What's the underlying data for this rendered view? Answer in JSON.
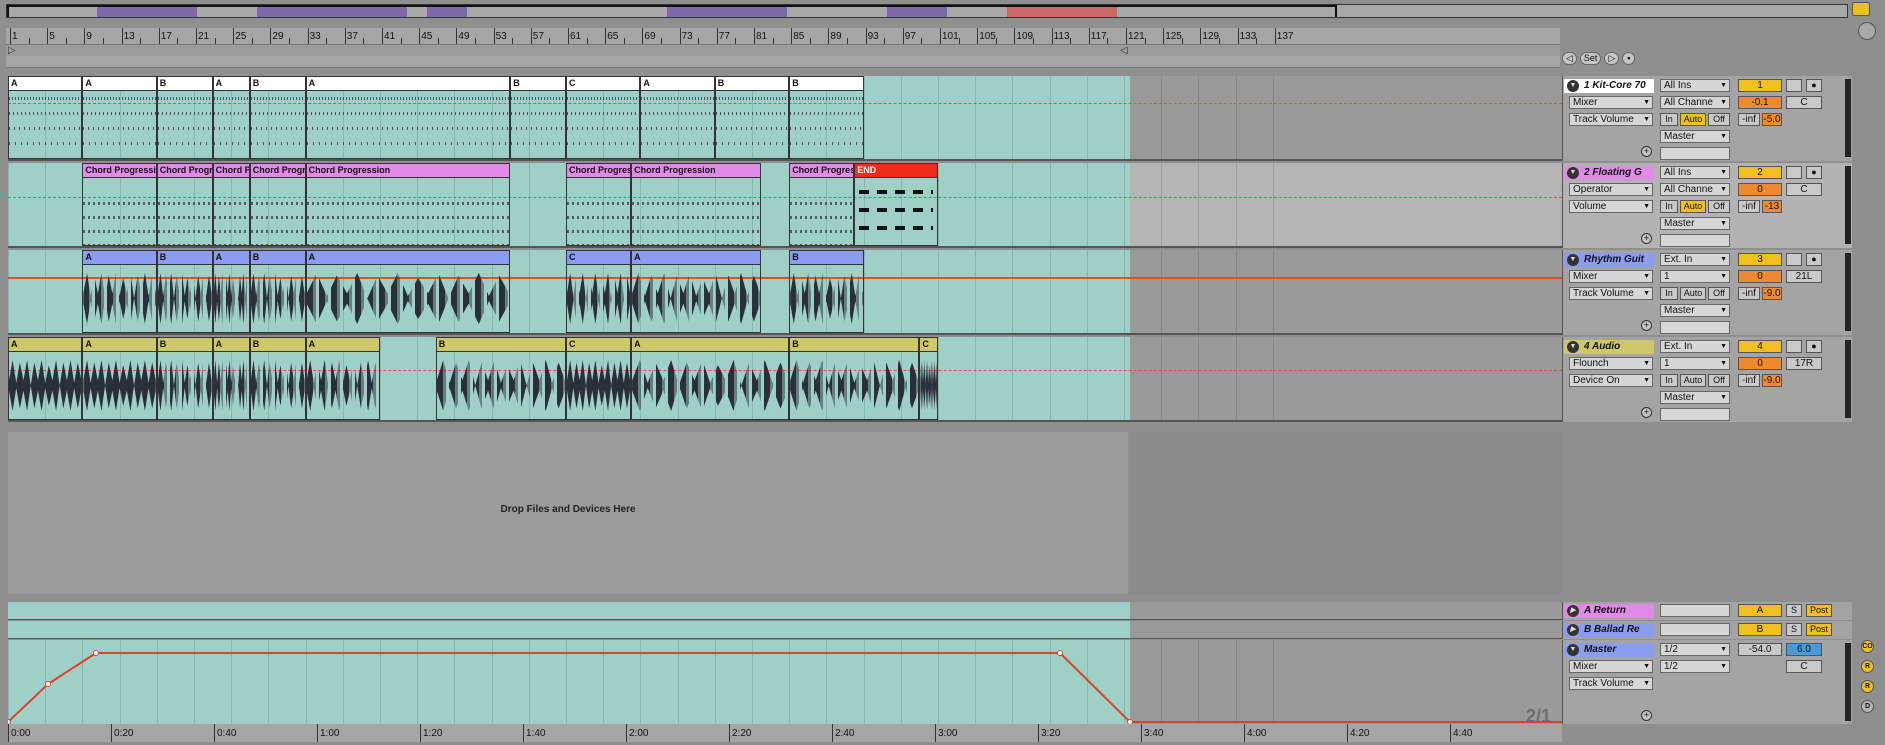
{
  "ruler": {
    "bars": [
      "1",
      "5",
      "9",
      "13",
      "17",
      "21",
      "25",
      "29",
      "33",
      "37",
      "41",
      "45",
      "49",
      "53",
      "57",
      "61",
      "65",
      "69",
      "73",
      "77",
      "81",
      "85",
      "89",
      "93",
      "97",
      "101",
      "105",
      "109",
      "113",
      "117",
      "121",
      "125",
      "129",
      "133",
      "137"
    ]
  },
  "set_controls": {
    "set_label": "Set"
  },
  "tracks": [
    {
      "name": "1 Kit-Core 70",
      "color": "#ffffff",
      "input": "All Ins",
      "device": "Mixer",
      "channel": "All Channe",
      "param": "Track Volume",
      "number": "1",
      "volume": "-0.1",
      "pan": "C",
      "mon_in": "In",
      "mon_auto": "Auto",
      "mon_off": "Off",
      "inf": "-inf",
      "peak": "-5.0",
      "output": "Master",
      "clips": [
        "A",
        "A",
        "B",
        "A",
        "B",
        "A",
        "B",
        "C",
        "A",
        "B",
        "B"
      ]
    },
    {
      "name": "2 Floating G",
      "color": "#e08be8",
      "input": "All Ins",
      "device": "Operator",
      "channel": "All Channe",
      "param": "Volume",
      "number": "2",
      "volume": "0",
      "pan": "C",
      "mon_in": "In",
      "mon_auto": "Auto",
      "mon_off": "Off",
      "inf": "-inf",
      "peak": "-13",
      "output": "Master",
      "clips": [
        "Chord Progression",
        "Chord Progres",
        "Chord Pr",
        "Chord Progres",
        "Chord Progression",
        "Chord Progressi",
        "Chord Progression",
        "Chord Progress",
        "END"
      ]
    },
    {
      "name": "Rhythm Guit",
      "color": "#8b9df0",
      "input": "Ext. In",
      "device": "Mixer",
      "channel": "1",
      "param": "Track Volume",
      "number": "3",
      "volume": "0",
      "pan": "21L",
      "mon_in": "In",
      "mon_auto": "Auto",
      "mon_off": "Off",
      "inf": "-inf",
      "peak": "-9.0",
      "output": "Master",
      "clips": [
        "A",
        "B",
        "A",
        "B",
        "A",
        "C",
        "A",
        "B"
      ]
    },
    {
      "name": "4 Audio",
      "color": "#cfc86a",
      "input": "Ext. In",
      "device": "Flounch",
      "channel": "1",
      "param": "Device On",
      "number": "4",
      "volume": "0",
      "pan": "17R",
      "mon_in": "In",
      "mon_auto": "Auto",
      "mon_off": "Off",
      "inf": "-inf",
      "peak": "-9.0",
      "output": "Master",
      "clips": [
        "A",
        "A",
        "B",
        "A",
        "B",
        "A",
        "B",
        "C",
        "A",
        "B",
        "C"
      ]
    }
  ],
  "drop_message": "Drop Files and Devices Here",
  "returns": [
    {
      "name": "A Return",
      "color": "#e08be8",
      "letter": "A",
      "solo": "S",
      "post": "Post"
    },
    {
      "name": "B Ballad Re",
      "color": "#8b9df0",
      "letter": "B",
      "solo": "S",
      "post": "Post"
    }
  ],
  "master": {
    "name": "Master",
    "color": "#8b9df0",
    "device": "Mixer",
    "param": "Track Volume",
    "cue1": "1/2",
    "cue2": "1/2",
    "vol": "-54.0",
    "level": "6.0",
    "pan": "C"
  },
  "time_ruler": [
    "0:00",
    "0:20",
    "0:40",
    "1:00",
    "1:20",
    "1:40",
    "2:00",
    "2:20",
    "2:40",
    "3:00",
    "3:20",
    "3:40",
    "4:00",
    "4:20",
    "4:40"
  ],
  "zoom": "2/1",
  "solo_label": "S",
  "side_buttons": [
    "CO",
    "R",
    "R",
    "D"
  ]
}
